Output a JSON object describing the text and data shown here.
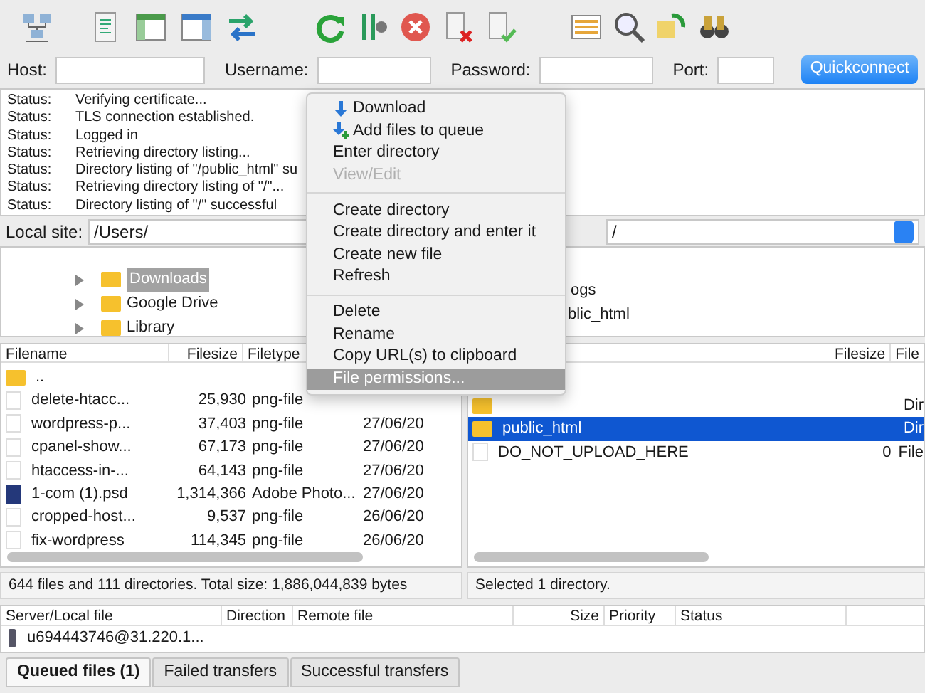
{
  "quickconnect": {
    "fields": [
      {
        "label": "Host:"
      },
      {
        "label": "Username:"
      },
      {
        "label": "Password:"
      },
      {
        "label": "Port:"
      }
    ],
    "button": "Quickconnect"
  },
  "log": [
    {
      "label": "Status:",
      "message": "Verifying certificate..."
    },
    {
      "label": "Status:",
      "message": "TLS connection established."
    },
    {
      "label": "Status:",
      "message": "Logged in"
    },
    {
      "label": "Status:",
      "message": "Retrieving directory listing..."
    },
    {
      "label": "Status:",
      "message": "Directory listing of \"/public_html\" su"
    },
    {
      "label": "Status:",
      "message": "Retrieving directory listing of \"/\"..."
    },
    {
      "label": "Status:",
      "message": "Directory listing of \"/\" successful"
    }
  ],
  "local_site": {
    "label": "Local site:",
    "path": "/Users/"
  },
  "remote_site": {
    "path": "/"
  },
  "local_tree": [
    {
      "name": "Downloads",
      "selected": true
    },
    {
      "name": "Google Drive",
      "selected": false
    },
    {
      "name": "Library",
      "selected": false
    }
  ],
  "remote_tree": [
    {
      "name": "ogs"
    },
    {
      "name": "blic_html"
    }
  ],
  "local_files": {
    "columns": [
      "Filename",
      "Filesize",
      "Filetype"
    ],
    "rows": [
      {
        "kind": "folder",
        "name": ".."
      },
      {
        "kind": "file",
        "name": "delete-htacc...",
        "size": "25,930",
        "type": "png-file"
      },
      {
        "kind": "file",
        "name": "wordpress-p...",
        "size": "37,403",
        "type": "png-file",
        "modified": "27/06/20"
      },
      {
        "kind": "file",
        "name": "cpanel-show...",
        "size": "67,173",
        "type": "png-file",
        "modified": "27/06/20"
      },
      {
        "kind": "file",
        "name": "htaccess-in-...",
        "size": "64,143",
        "type": "png-file",
        "modified": "27/06/20"
      },
      {
        "kind": "psd",
        "name": "1-com (1).psd",
        "size": "1,314,366",
        "type": "Adobe Photo...",
        "modified": "27/06/20"
      },
      {
        "kind": "file",
        "name": "cropped-host...",
        "size": "9,537",
        "type": "png-file",
        "modified": "26/06/20"
      },
      {
        "kind": "file",
        "name": "fix-wordpress",
        "size": "114,345",
        "type": "png-file",
        "modified": "26/06/20"
      }
    ],
    "status": "644 files and 111 directories. Total size: 1,886,044,839 bytes"
  },
  "remote_files": {
    "columns": [
      "Filesize",
      "File"
    ],
    "rows": [
      {
        "kind": "folder",
        "type": "Dir",
        "selected": false
      },
      {
        "kind": "folder",
        "name": "public_html",
        "type": "Dir",
        "selected": true
      },
      {
        "kind": "file",
        "name": "DO_NOT_UPLOAD_HERE",
        "size": "0",
        "type": "File",
        "selected": false
      }
    ],
    "status": "Selected 1 directory."
  },
  "queue": {
    "columns": [
      "Server/Local file",
      "Direction",
      "Remote file",
      "Size",
      "Priority",
      "Status"
    ],
    "rows": [
      {
        "server": "u694443746@31.220.1..."
      }
    ]
  },
  "tabs": [
    {
      "label": "Queued files (1)",
      "selected": true
    },
    {
      "label": "Failed transfers",
      "selected": false
    },
    {
      "label": "Successful transfers",
      "selected": false
    }
  ],
  "context_menu": {
    "items": [
      {
        "kind": "download",
        "label": "Download",
        "disabled": false,
        "selected": false
      },
      {
        "kind": "enqueue",
        "label": "Add files to queue",
        "disabled": false,
        "selected": false
      },
      {
        "kind": "plain",
        "label": "Enter directory",
        "disabled": false,
        "selected": false
      },
      {
        "kind": "plain",
        "label": "View/Edit",
        "disabled": true,
        "selected": false
      },
      {
        "kind": "separator"
      },
      {
        "kind": "plain",
        "label": "Create directory",
        "disabled": false,
        "selected": false
      },
      {
        "kind": "plain",
        "label": "Create directory and enter it",
        "disabled": false,
        "selected": false
      },
      {
        "kind": "plain",
        "label": "Create new file",
        "disabled": false,
        "selected": false
      },
      {
        "kind": "plain",
        "label": "Refresh",
        "disabled": false,
        "selected": false
      },
      {
        "kind": "separator"
      },
      {
        "kind": "plain",
        "label": "Delete",
        "disabled": false,
        "selected": false
      },
      {
        "kind": "plain",
        "label": "Rename",
        "disabled": false,
        "selected": false
      },
      {
        "kind": "plain",
        "label": "Copy URL(s) to clipboard",
        "disabled": false,
        "selected": false
      },
      {
        "kind": "plain",
        "label": "File permissions...",
        "disabled": false,
        "selected": true
      }
    ]
  }
}
